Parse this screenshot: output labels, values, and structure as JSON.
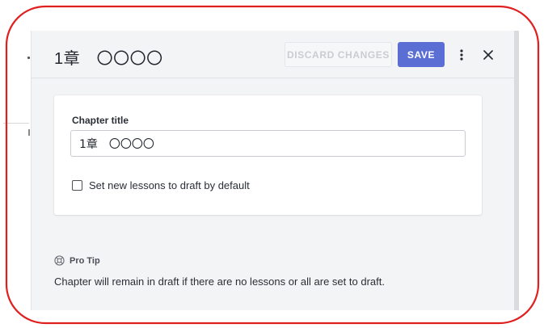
{
  "panel": {
    "title": "1章　〇〇〇〇",
    "discard_label": "DISCARD CHANGES",
    "save_label": "SAVE",
    "more_icon": "vertical-dots-icon",
    "close_icon": "close-icon"
  },
  "form": {
    "chapter_title_label": "Chapter title",
    "chapter_title_value": "1章　〇〇〇〇",
    "draft_checkbox_label": "Set new lessons to draft by default",
    "draft_checkbox_checked": false
  },
  "pro_tip": {
    "icon": "lifebuoy-icon",
    "title": "Pro Tip",
    "text": "Chapter will remain in draft if there are no lessons or all are set to draft."
  },
  "colors": {
    "accent": "#5b6ed4",
    "highlight": "#e0201f",
    "panel_bg": "#f3f4f6"
  }
}
